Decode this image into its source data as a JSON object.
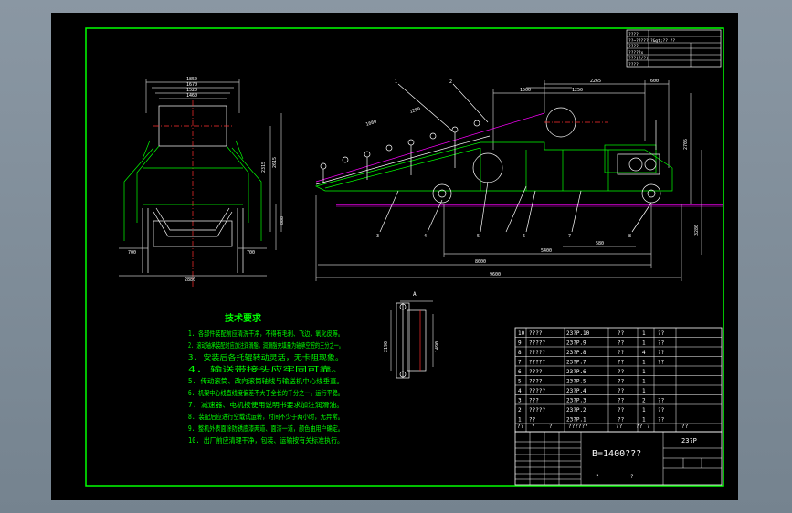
{
  "colors": {
    "background": "#7f8d99",
    "sheet": "#000000",
    "frame": "#00ff00",
    "machine": "#ffffff",
    "dim": "#c0c0c0",
    "belt": "#ff00ff",
    "accent": "#ffff00",
    "text": "#ffffff",
    "notes": "#00ff00"
  },
  "drawing": {
    "title_main": "B=1400???",
    "drawing_no": "23?P",
    "q1": "?",
    "q2": "?"
  },
  "spec_table": {
    "rows": [
      [
        "????",
        ""
      ],
      [
        "??~?????",
        "?&gt;?? ??"
      ],
      [
        "????",
        ""
      ],
      [
        "?????x",
        ""
      ],
      [
        "???(?/?)",
        ""
      ],
      [
        "????",
        ""
      ]
    ]
  },
  "front_view": {
    "dims": {
      "d1": "1850",
      "d2": "1670",
      "d3": "1520",
      "d4": "1460",
      "h1": "2315",
      "h2": "2615",
      "h3": "888",
      "w_left": "700",
      "w_right": "700",
      "base": "2880"
    }
  },
  "side_view": {
    "callouts": [
      "1",
      "2",
      "3",
      "4",
      "5",
      "6",
      "7",
      "8"
    ],
    "dims": {
      "top1": "1500",
      "top2": "1250",
      "top3": "2265",
      "top4": "600",
      "left1": "1660",
      "left2": "1250",
      "right1": "2705",
      "right2": "3280",
      "b1": "580",
      "b2": "5400",
      "b3": "8000",
      "b4": "9600"
    }
  },
  "detail_view": {
    "label": "A",
    "dims": {
      "h": "2190",
      "w": "1490"
    }
  },
  "notes": {
    "title": "技术要求",
    "items": [
      "1. 各部件装配前应清洗干净，不得有毛刺、飞边、氧化皮等。",
      "2. 滚动轴承装配时应加注润滑脂，润滑脂充填量为轴承空腔的三分之一。",
      "3. 安装后各托辊转动灵活，无卡阻现象。",
      "4. 输送带接头应牢固可靠。",
      "5. 传动滚筒、改向滚筒轴线与输送机中心线垂直。",
      "6. 机架中心线直线度偏差不大于全长的千分之一，运行平稳。",
      "7. 减速器、电机按使用说明书要求加注润滑油。",
      "8. 装配后应进行空载试运转，时间不少于两小时，无异常。",
      "9. 整机外表面涂防锈底漆两道、面漆一道，颜色由用户确定。",
      "10. 出厂前应清理干净，包装、运输按有关标准执行。"
    ]
  },
  "bom": {
    "rows": [
      {
        "no": "10",
        "name": "????",
        "code": "23?P.10",
        "qty": "??",
        "n": "1",
        "mat": "??"
      },
      {
        "no": "9",
        "name": "?????",
        "code": "23?P.9",
        "qty": "??",
        "n": "1",
        "mat": "??"
      },
      {
        "no": "8",
        "name": "?????",
        "code": "23?P.8",
        "qty": "??",
        "n": "4",
        "mat": "??"
      },
      {
        "no": "7",
        "name": "?????",
        "code": "23?P.7",
        "qty": "??",
        "n": "1",
        "mat": "??"
      },
      {
        "no": "6",
        "name": "????",
        "code": "23?P.6",
        "qty": "??",
        "n": "1",
        "mat": ""
      },
      {
        "no": "5",
        "name": "????",
        "code": "23?P.5",
        "qty": "??",
        "n": "1",
        "mat": ""
      },
      {
        "no": "4",
        "name": "?????",
        "code": "23?P.4",
        "qty": "??",
        "n": "1",
        "mat": ""
      },
      {
        "no": "3",
        "name": "???",
        "code": "23?P.3",
        "qty": "??",
        "n": "2",
        "mat": "??"
      },
      {
        "no": "2",
        "name": "?????",
        "code": "23?P.2",
        "qty": "??",
        "n": "1",
        "mat": "??"
      },
      {
        "no": "1",
        "name": "??",
        "code": "23?P.1",
        "qty": "??",
        "n": "1",
        "mat": "??"
      }
    ],
    "header": [
      "??",
      "?",
      "?",
      "??????",
      "??",
      "??",
      "?",
      "??"
    ]
  }
}
